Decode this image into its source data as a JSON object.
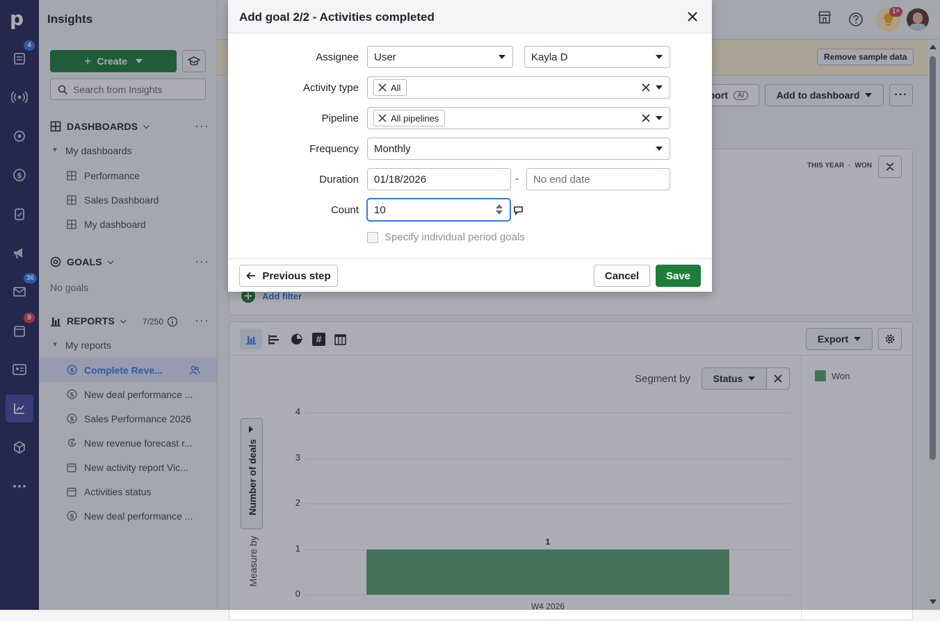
{
  "app": {
    "section_title": "Insights"
  },
  "rail": {
    "badges": {
      "leads": "4",
      "mail": "36",
      "activities": "9"
    },
    "notif_badge": "1+"
  },
  "sidebar": {
    "create_label": "Create",
    "search_placeholder": "Search from Insights",
    "dashboards_header": "DASHBOARDS",
    "my_dashboards": "My dashboards",
    "dashboards": [
      "Performance",
      "Sales Dashboard",
      "My dashboard"
    ],
    "goals_header": "GOALS",
    "no_goals": "No goals",
    "reports_header": "REPORTS",
    "reports_count": "7/250",
    "my_reports": "My reports",
    "reports": [
      "Complete Reve...",
      "New deal performance ...",
      "Sales Performance 2026",
      "New revenue forecast r...",
      "New activity report Vic...",
      "Activities status",
      "New deal performance ..."
    ]
  },
  "header": {
    "remove_sample": "Remove sample data",
    "export_partial": "port",
    "ai_badge": "AI",
    "add_to_dashboard": "Add to dashboard",
    "filter_tags": [
      "THIS YEAR",
      "WON"
    ],
    "add_filter": "Add filter"
  },
  "report": {
    "export_label": "Export",
    "segment_by_label": "Segment by",
    "segment_value": "Status",
    "legend": [
      "Won"
    ],
    "measure_by_label": "Measure by",
    "measure_value": "Number of deals",
    "colors": {
      "won": "#5aa06c"
    }
  },
  "chart_data": {
    "type": "bar",
    "categories": [
      "W4 2026"
    ],
    "series": [
      {
        "name": "Won",
        "values": [
          1
        ]
      }
    ],
    "ylim": [
      0,
      4
    ],
    "yticks": [
      0,
      1,
      2,
      3,
      4
    ],
    "ylabel": "Number of deals",
    "xlabel": ""
  },
  "modal": {
    "title": "Add goal 2/2 - Activities completed",
    "fields": {
      "assignee_label": "Assignee",
      "assignee_type": "User",
      "assignee_value": "Kayla D",
      "activity_type_label": "Activity type",
      "activity_type_value": "All",
      "pipeline_label": "Pipeline",
      "pipeline_value": "All pipelines",
      "frequency_label": "Frequency",
      "frequency_value": "Monthly",
      "duration_label": "Duration",
      "duration_start": "01/18/2026",
      "duration_sep": "-",
      "duration_end_placeholder": "No end date",
      "count_label": "Count",
      "count_value": "10",
      "specify_label": "Specify individual period goals"
    },
    "prev_step": "Previous step",
    "cancel": "Cancel",
    "save": "Save"
  }
}
